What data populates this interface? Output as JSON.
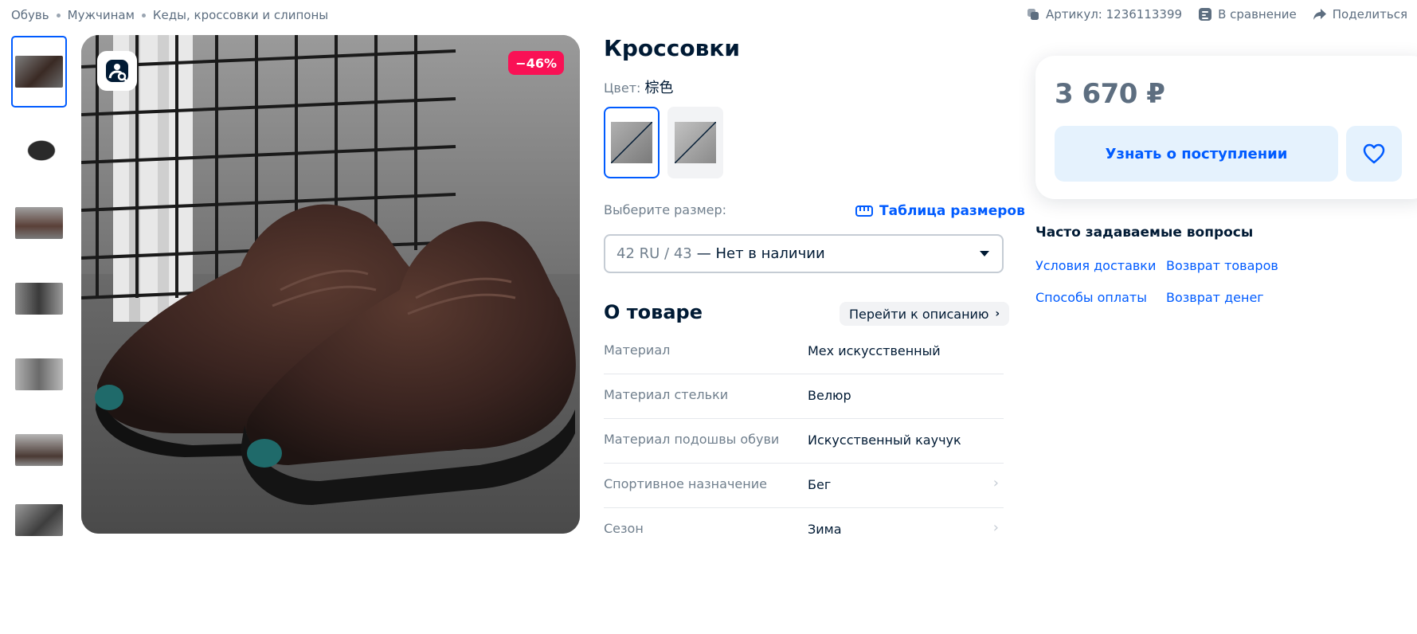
{
  "breadcrumb": [
    "Обувь",
    "Мужчинам",
    "Кеды, кроссовки и слипоны"
  ],
  "top_actions": {
    "sku": "Артикул: 1236113399",
    "compare": "В сравнение",
    "share": "Поделиться"
  },
  "gallery": {
    "thumbnails": [
      "thumb-1",
      "thumb-2",
      "thumb-3",
      "thumb-4",
      "thumb-5",
      "thumb-6",
      "thumb-7"
    ],
    "active_thumbnail": 0,
    "discount_badge": "−46%"
  },
  "product": {
    "title": "Кроссовки",
    "color_label": "Цвет:",
    "color_value": "棕色",
    "size_label": "Выберите размер:",
    "size_table_link": "Таблица размеров",
    "size_select_size": "42 RU / 43",
    "size_select_status": "— Нет в наличии"
  },
  "about": {
    "title": "О товаре",
    "to_description": "Перейти к описанию",
    "specs": [
      {
        "key": "Материал",
        "value": "Мех искусственный",
        "link": false
      },
      {
        "key": "Материал стельки",
        "value": "Велюр",
        "link": false
      },
      {
        "key": "Материал подошвы обуви",
        "value": "Искусственный каучук",
        "link": false
      },
      {
        "key": "Спортивное назначение",
        "value": "Бег",
        "link": true
      },
      {
        "key": "Сезон",
        "value": "Зима",
        "link": true
      }
    ]
  },
  "price_card": {
    "price": "3 670 ₽",
    "notify_button": "Узнать о поступлении"
  },
  "faq": {
    "title": "Часто задаваемые вопросы",
    "links": [
      "Условия доставки",
      "Возврат товаров",
      "Способы оплаты",
      "Возврат денег"
    ]
  },
  "colors": {
    "accent": "#005bff",
    "discount": "#f91155",
    "price": "#5d6e80"
  }
}
